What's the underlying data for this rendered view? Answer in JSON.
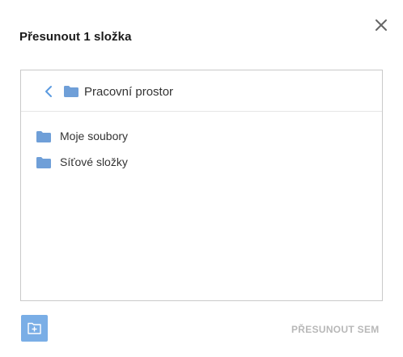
{
  "dialog": {
    "title": "Přesunout 1 složka",
    "close_icon": "close-icon"
  },
  "browser": {
    "back_icon": "chevron-left-icon",
    "current_folder": "Pracovní prostor",
    "items": [
      {
        "label": "Moje soubory",
        "icon": "folder-icon"
      },
      {
        "label": "Síťové složky",
        "icon": "folder-icon"
      }
    ]
  },
  "footer": {
    "new_folder_icon": "new-folder-icon",
    "move_label": "PŘESUNOUT SEM"
  },
  "colors": {
    "folder": "#6f9fd8",
    "accent": "#7aaee6",
    "disabled_text": "#b8b8b8",
    "back_chevron": "#5b9be0"
  }
}
